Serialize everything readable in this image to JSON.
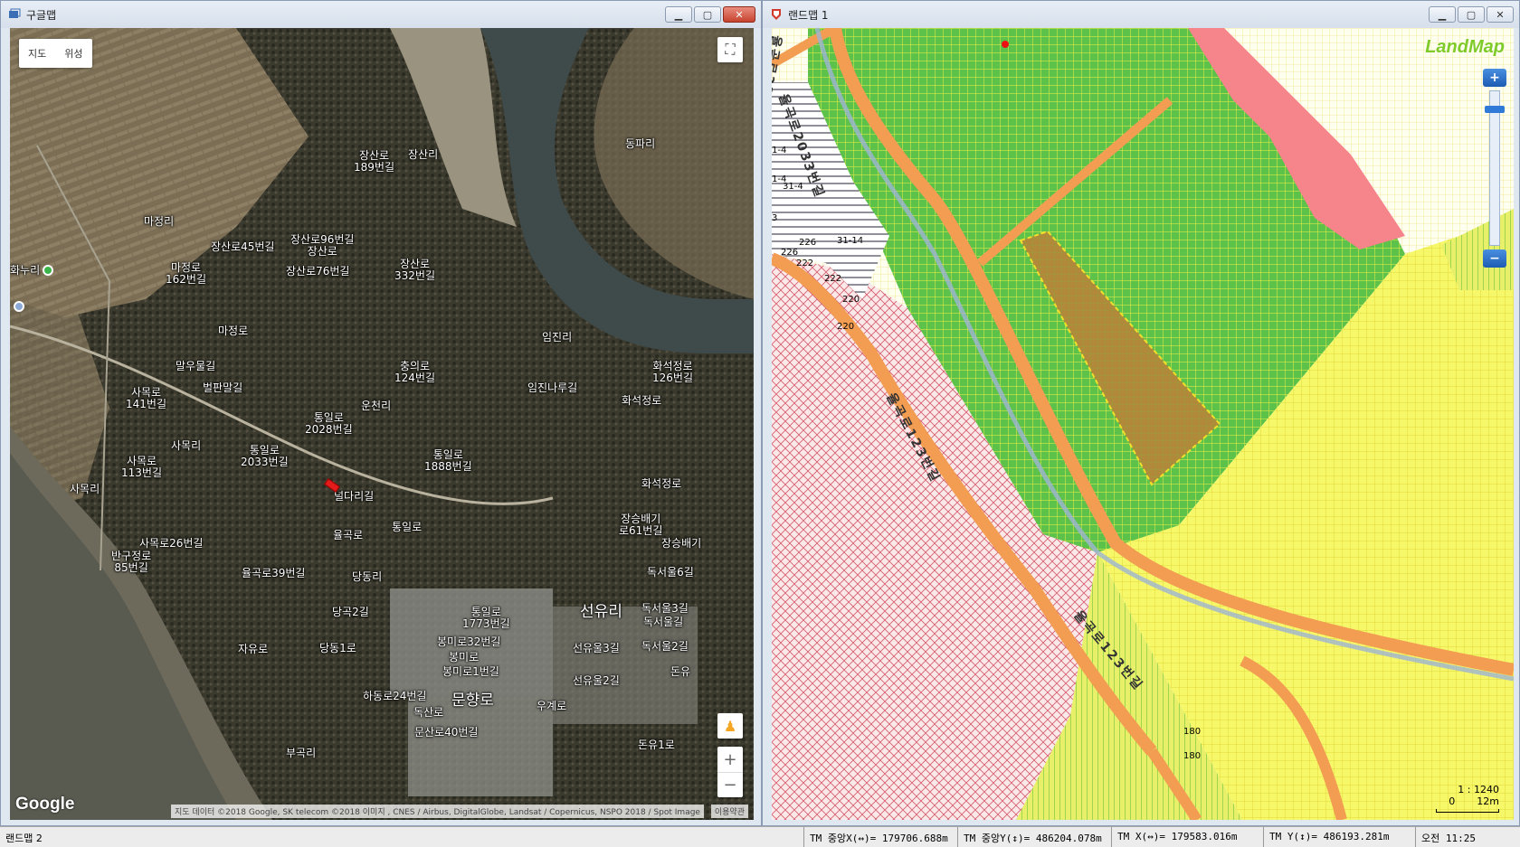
{
  "google_window": {
    "title": "구글맵",
    "map_type": {
      "map": "지도",
      "satellite": "위성"
    },
    "logo": "Google",
    "attribution": "지도 데이터 ©2018 Google, SK telecom ©2018 이미지 , CNES / Airbus, DigitalGlobe, Landsat / Copernicus, NSPO 2018 / Spot Image",
    "terms": "이용약관",
    "places": [
      "장산로\n189번길",
      "장산리",
      "동파리",
      "마정리",
      "장산로96번길\n장산로",
      "장산로45번길",
      "마정로\n162번길",
      "장산로76번길",
      "장산로\n332번길",
      "화누리",
      "마정로",
      "임진리",
      "말우물길",
      "충의로\n124번길",
      "화석정로\n126번길",
      "사목로\n141번길",
      "벌판말길",
      "통일로\n2028번길",
      "운천리",
      "임진나루길",
      "화석정로",
      "사목리",
      "통일로\n2033번길",
      "사목로\n113번길",
      "통일로\n1888번길",
      "화석정로",
      "사목리",
      "널다리길",
      "통일로",
      "장승배기\n로61번길",
      "사목로26번길",
      "장승배기",
      "반구정로\n85번길",
      "율곡로",
      "율곡로39번길",
      "당동리",
      "독서울6길",
      "당곡2길",
      "통일로\n1773번길",
      "선유리",
      "독서울3길",
      "독서울길",
      "봉미로32번길",
      "당동1로",
      "자유로",
      "봉미로",
      "선유울3길",
      "독서울2길",
      "봉미로1번길",
      "돈유",
      "선유울2길",
      "하동로24번길",
      "문향로",
      "독산로",
      "우계로",
      "문산로40번길",
      "돈유1로",
      "부곡리"
    ]
  },
  "landmap_window": {
    "title": "랜드맵 1",
    "logo": "LandMap",
    "zoom_in": "+",
    "zoom_out": "−",
    "scale_ratio": "1 : 1240",
    "scale_zero": "0",
    "scale_len": "12m",
    "road_labels": [
      "율곡로2033번길",
      "율곡로123번길",
      "율곡로123번길",
      "율곡로33번길"
    ],
    "lot_labels": [
      "1-4",
      "1-4",
      "31-4",
      "3",
      "226",
      "31-14",
      "226",
      "222",
      "222",
      "220",
      "220",
      "180",
      "180"
    ]
  },
  "status_bar": {
    "left_title": "랜드맵 2",
    "tm_center_x": "TM 중앙X(↔)= 179706.688m",
    "tm_center_y": "TM 중앙Y(↕)= 486204.078m",
    "tm_x": "TM X(↔)= 179583.016m",
    "tm_y": "TM Y(↕)= 486193.281m",
    "clock": "오전 11:25"
  }
}
